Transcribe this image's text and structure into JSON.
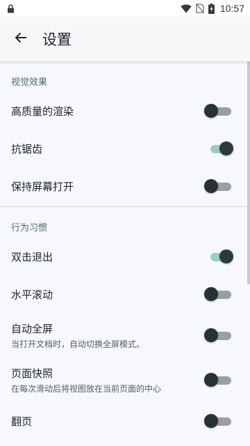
{
  "status_bar": {
    "time": "10:57"
  },
  "app_bar": {
    "title": "设置"
  },
  "sections": [
    {
      "header": "视觉效果",
      "items": [
        {
          "label": "高质量的渲染",
          "on": false
        },
        {
          "label": "抗锯齿",
          "on": true
        },
        {
          "label": "保持屏幕打开",
          "on": false
        }
      ]
    },
    {
      "header": "行为习惯",
      "items": [
        {
          "label": "双击退出",
          "on": true
        },
        {
          "label": "水平滚动",
          "on": false
        },
        {
          "label": "自动全屏",
          "desc": "当打开文档时，自动切换全屏模式。",
          "on": false
        },
        {
          "label": "页面快照",
          "desc": "在每次滑动后将视图放在当前页面的中心",
          "on": false
        },
        {
          "label": "翻页",
          "on": false
        }
      ]
    }
  ],
  "colors": {
    "accent": "#9ccdc4",
    "section_header": "#4a6b68",
    "background": "#f6f8fb"
  }
}
